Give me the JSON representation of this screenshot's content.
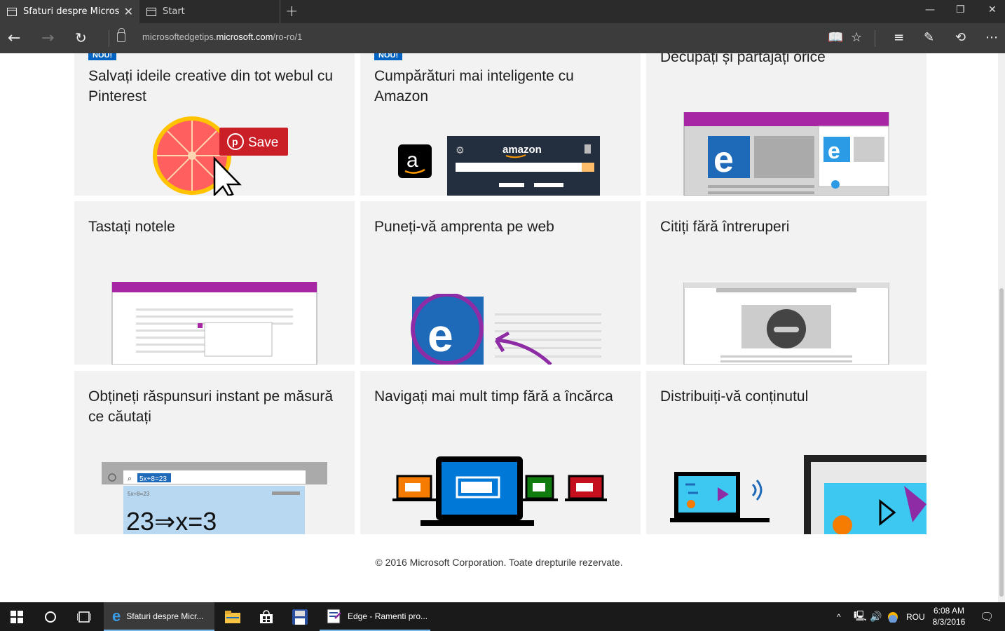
{
  "browser": {
    "tabs": [
      {
        "title": "Sfaturi despre Microsoft",
        "active": true
      },
      {
        "title": "Start",
        "active": false
      }
    ],
    "url_prefix": "microsoftedgetips.",
    "url_domain": "microsoft.com",
    "url_path": "/ro-ro/1"
  },
  "page": {
    "cards": [
      {
        "title": "Salvați ideile creative din tot webul cu Pinterest",
        "badge": "NOU!",
        "button": "Save"
      },
      {
        "title": "Cumpărături mai inteligente cu Amazon",
        "badge": "NOU!",
        "brand": "amazon"
      },
      {
        "title": "Decupați și partajați orice"
      },
      {
        "title": "Tastați notele"
      },
      {
        "title": "Puneți-vă amprenta pe web"
      },
      {
        "title": "Citiți fără întreruperi"
      },
      {
        "title": "Obțineți răspunsuri instant pe măsură ce căutați",
        "search_text": "5x+8=23",
        "suggestion": "5x+8=23",
        "answer": "23⇒x=3"
      },
      {
        "title": "Navigați mai mult timp fără a încărca"
      },
      {
        "title": "Distribuiți-vă conținutul"
      }
    ],
    "footer": "© 2016 Microsoft Corporation. Toate drepturile rezervate."
  },
  "taskbar": {
    "apps": [
      {
        "label": "Sfaturi despre Micr...",
        "icon": "edge-icon"
      },
      {
        "label": "Edge - Ramenti pro...",
        "icon": "document-app-icon"
      }
    ],
    "language": "ROU",
    "time": "6:08 AM",
    "date": "8/3/2016"
  }
}
